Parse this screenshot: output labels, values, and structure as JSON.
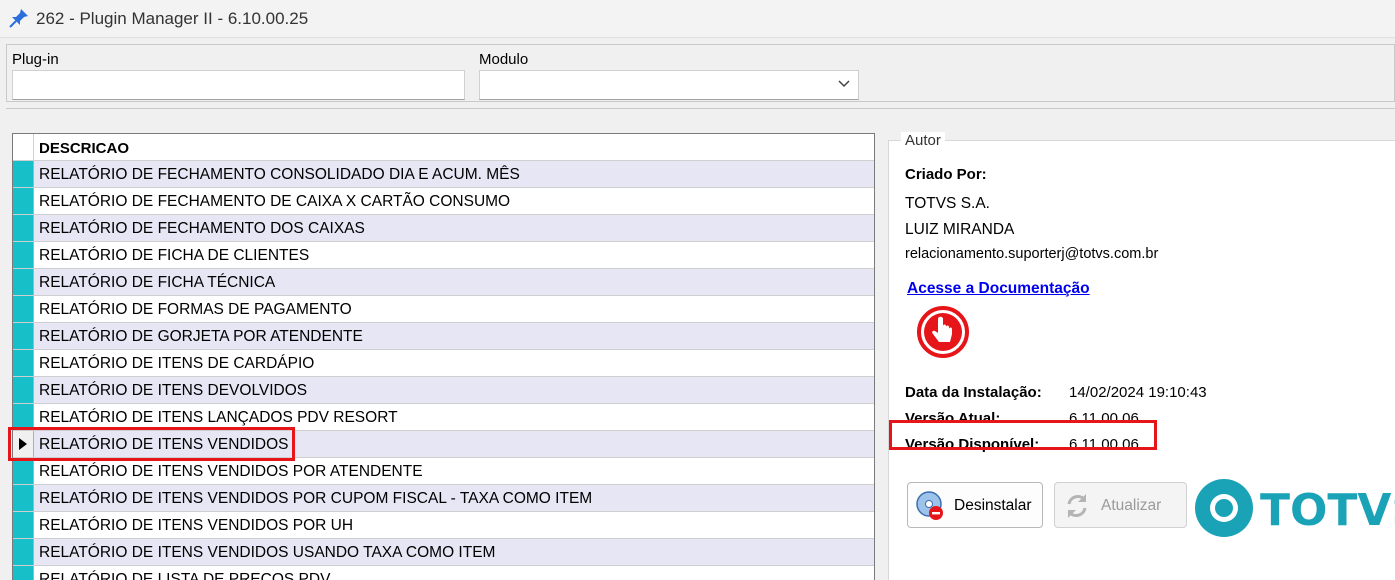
{
  "window": {
    "title": "262 - Plugin Manager II - 6.10.00.25",
    "icon": "pin-icon"
  },
  "filters": {
    "plugin_label": "Plug-in",
    "plugin_value": "",
    "modulo_label": "Modulo",
    "modulo_value": ""
  },
  "grid": {
    "header": "DESCRICAO",
    "rows": [
      "RELATÓRIO DE FECHAMENTO CONSOLIDADO DIA E ACUM. MÊS",
      "RELATÓRIO DE FECHAMENTO DE CAIXA X CARTÃO CONSUMO",
      "RELATÓRIO DE FECHAMENTO DOS CAIXAS",
      "RELATÓRIO DE FICHA DE CLIENTES",
      "RELATÓRIO DE FICHA TÉCNICA",
      "RELATÓRIO DE FORMAS DE PAGAMENTO",
      "RELATÓRIO DE GORJETA POR ATENDENTE",
      "RELATÓRIO DE ITENS DE CARDÁPIO",
      "RELATÓRIO DE ITENS DEVOLVIDOS",
      "RELATÓRIO DE ITENS LANÇADOS PDV RESORT",
      "RELATÓRIO DE ITENS VENDIDOS",
      "RELATÓRIO DE ITENS VENDIDOS POR ATENDENTE",
      "RELATÓRIO DE ITENS VENDIDOS POR CUPOM FISCAL - TAXA COMO ITEM",
      "RELATÓRIO DE ITENS VENDIDOS POR UH",
      "RELATÓRIO DE ITENS VENDIDOS USANDO TAXA COMO ITEM",
      "RELATÓRIO DE LISTA DE PREÇOS PDV"
    ],
    "selected_index": 10,
    "indicator_color": "#17c0c8"
  },
  "author": {
    "legend": "Autor",
    "created_by_label": "Criado Por:",
    "company": "TOTVS S.A.",
    "person": "LUIZ MIRANDA",
    "email": "relacionamento.suporterj@totvs.com.br",
    "doc_link": "Acesse a Documentação",
    "install_date_label": "Data da Instalação:",
    "install_date": "14/02/2024 19:10:43",
    "current_version_label": "Versão Atual:",
    "current_version": "6.11.00.06",
    "available_version_label": "Versão Disponível:",
    "available_version": "6.11.00.06"
  },
  "actions": {
    "uninstall_label": "Desinstalar",
    "update_label": "Atualizar"
  },
  "brand": {
    "logo_text": "TOTVS",
    "accent": "#e5151a",
    "logo_color": "#1aa3b7"
  }
}
